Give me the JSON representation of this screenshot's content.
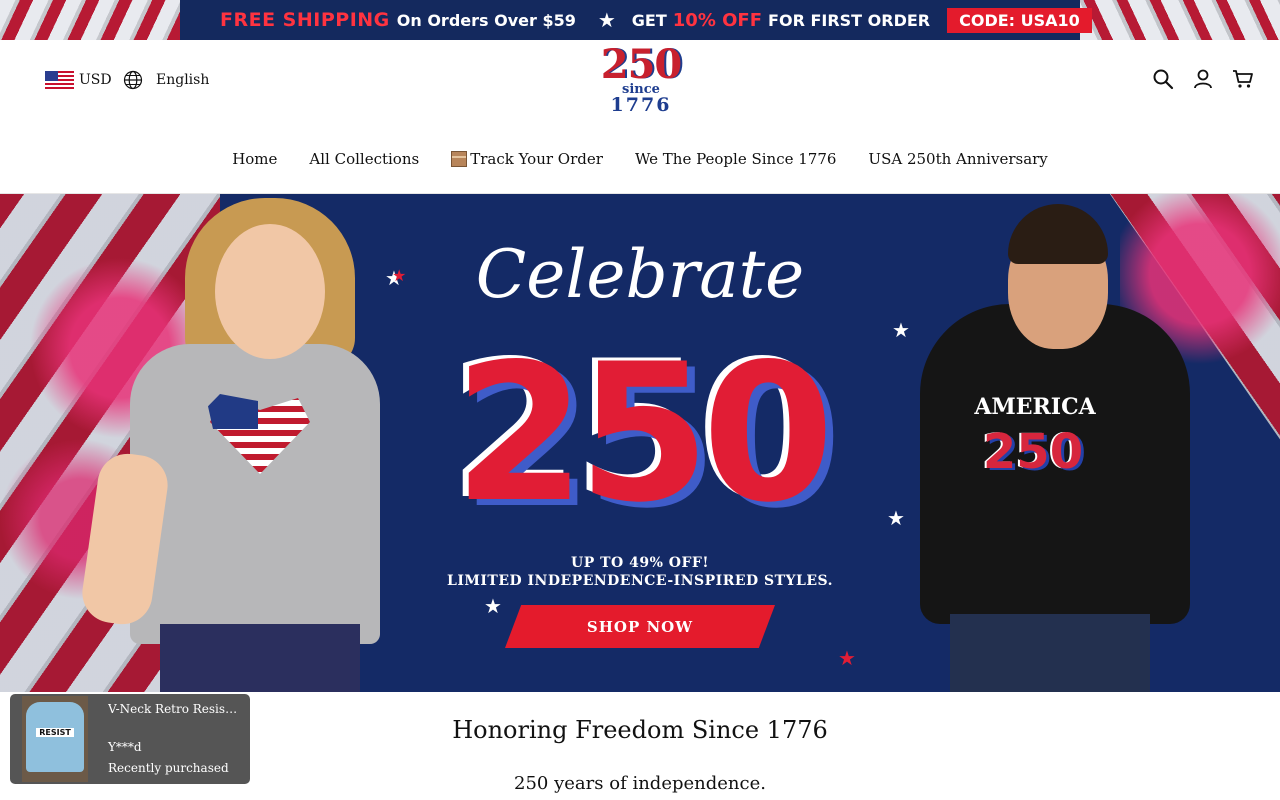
{
  "promo": {
    "part1_big": "FREE SHIPPING",
    "part1_small": "On Orders Over $59",
    "star_icon": "★",
    "part2_get": "GET",
    "part2_pct": "10% OFF",
    "part2_rest": "FOR FIRST ORDER",
    "code": "CODE: USA10"
  },
  "header": {
    "currency": "USD",
    "language": "English",
    "logo": {
      "number": "250",
      "since": "since",
      "year": "1776"
    },
    "icons": [
      "search-icon",
      "user-icon",
      "cart-icon"
    ]
  },
  "nav": {
    "items": [
      {
        "label": "Home"
      },
      {
        "label": "All Collections"
      },
      {
        "label": "Track Your Order"
      },
      {
        "label": "We The People Since 1776"
      },
      {
        "label": "USA 250th Anniversary"
      }
    ]
  },
  "hero": {
    "script_title": "Celebrate",
    "big_number": "250",
    "sub_line1": "UP TO 49% OFF!",
    "sub_line2": "LIMITED INDEPENDENCE-INSPIRED STYLES.",
    "cta": "SHOP NOW",
    "hoodie_text": "AMERICA",
    "hoodie_number": "250"
  },
  "section": {
    "title": "Honoring Freedom Since 1776",
    "subtitle": "250 years of independence."
  },
  "toast": {
    "product": "V-Neck Retro Resist ...",
    "tee_text": "RESIST",
    "buyer": "Y***d",
    "status": "Recently purchased"
  },
  "colors": {
    "promo_bg": "#14295e",
    "accent_red": "#e41b2c",
    "hero_bg": "#142a66",
    "logo_blue": "#1e3d8f"
  }
}
